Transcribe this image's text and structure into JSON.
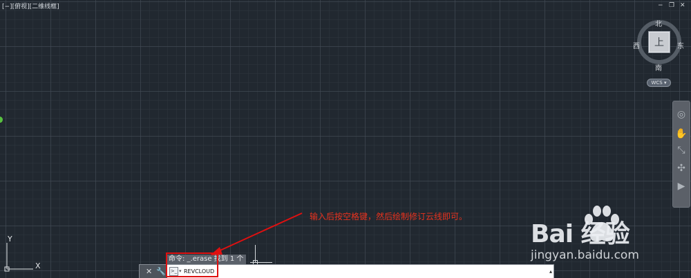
{
  "viewport": {
    "label": "[−][俯视][二维线框]"
  },
  "window_controls": {
    "minimize": "−",
    "restore": "❐",
    "close": "✕"
  },
  "viewcube": {
    "north": "北",
    "south": "南",
    "east": "东",
    "west": "西",
    "top_face": "上",
    "wcs_label": "WCS ▾"
  },
  "ucs": {
    "x_label": "X",
    "y_label": "Y"
  },
  "command": {
    "history_line": "命令: _.erase 找到 1 个",
    "input_value": "REVCLOUD",
    "close_glyph": "✕",
    "settings_glyph": "🔧",
    "prompt_glyph": ">_",
    "dropdown_glyph": "▴"
  },
  "annotation": {
    "text": "输入后按空格键，然后绘制修订云线即可。"
  },
  "watermark": {
    "brand": "Bai  经验",
    "url": "jingyan.baidu.com"
  },
  "colors": {
    "background": "#212830",
    "annotation": "#e8321e",
    "highlight": "#e01010"
  }
}
